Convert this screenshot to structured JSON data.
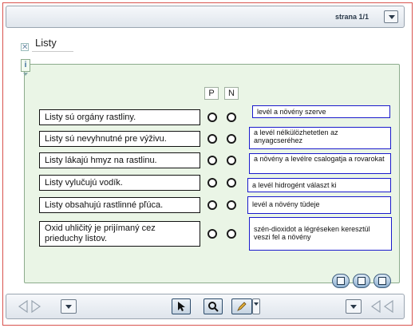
{
  "header": {
    "page_label": "strana 1/1"
  },
  "section": {
    "title": "Listy",
    "close_glyph": "✕",
    "info_glyph": "i"
  },
  "columns": {
    "p": "P",
    "n": "N"
  },
  "statements": [
    "Listy sú orgány rastliny.",
    "Listy sú nevyhnutné pre výživu.",
    "Listy lákajú hmyz na rastlinu.",
    "Listy vylučujú vodík.",
    "Listy obsahujú rastlinné pľúca.",
    "Oxid uhličitý je prijímaný cez prieduchy listov."
  ],
  "answers": [
    "levél a növény szerve",
    "a levél nélkülözhetetlen az anyagcseréhez",
    "a növény a levélre csalogatja a rovarokat",
    "a levél hidrogént választ ki",
    "levél a növény tüdeje",
    "szén-dioxidot a légréseken keresztül veszi fel a növény"
  ],
  "panel_buttons": [
    "info-button",
    "refresh-button",
    "check-button"
  ],
  "toolbar": {
    "pointer_icon": "pointer-icon",
    "search_icon": "search-icon",
    "pencil_icon": "pencil-icon"
  },
  "colors": {
    "panel_bg": "#eaf5e6",
    "answer_border": "#1a1acc",
    "frame_border": "#d9534f"
  }
}
